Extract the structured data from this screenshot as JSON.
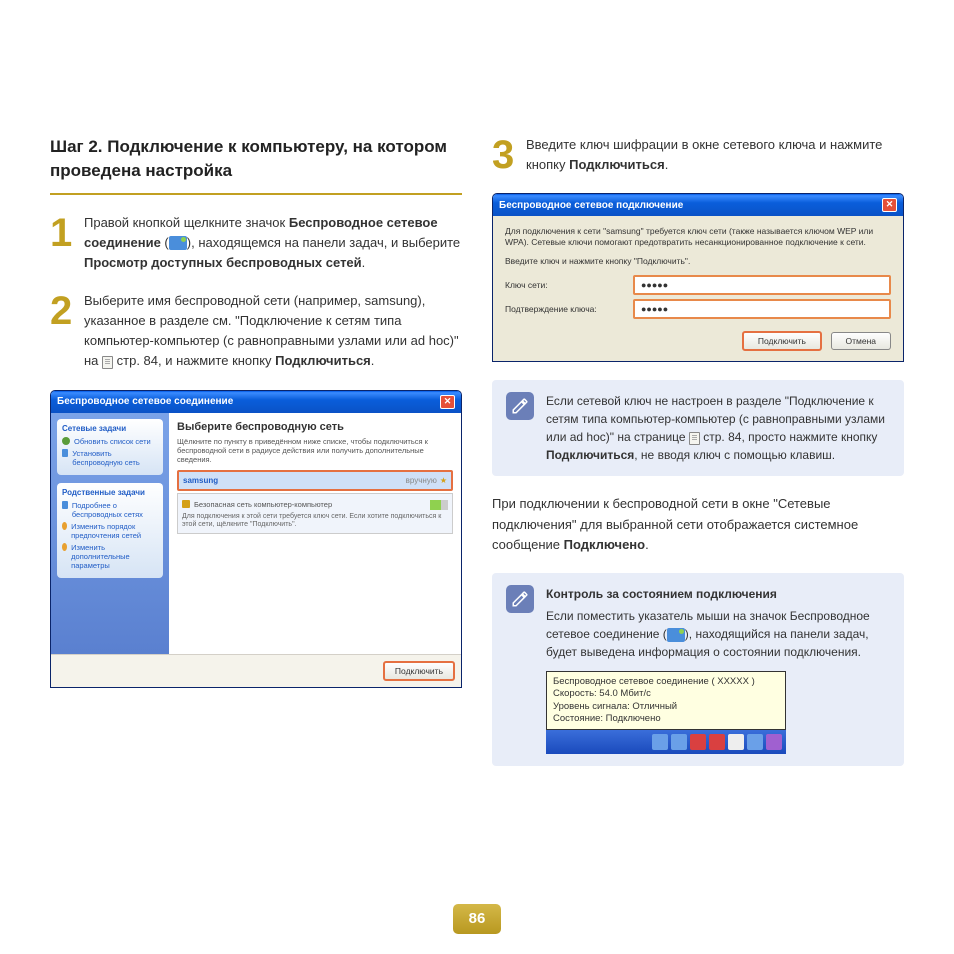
{
  "section_title": "Шаг 2. Подключение к компьютеру, на котором проведена настройка",
  "step1": {
    "p1a": "Правой кнопкой щелкните значок ",
    "p1b": "Беспроводное сетевое соединение",
    "p1c": " (",
    "p1d": "), находящемся на панели задач, и выберите ",
    "p1e": "Просмотр доступных беспроводных сетей",
    "p1f": "."
  },
  "step2": {
    "p1": "Выберите имя беспроводной сети (например, samsung), указанное в разделе см. \"Подключение к сетям типа компьютер-компьютер (с равноправными узлами или ad hoc)\" на ",
    "p2": " стр. 84, и нажмите кнопку ",
    "p2b": "Подключиться",
    "p2c": "."
  },
  "step3": {
    "p1": "Введите ключ шифрации в окне сетевого ключа и нажмите кнопку ",
    "p1b": "Подключиться",
    "p1c": "."
  },
  "win1": {
    "title": "Беспроводное сетевое соединение",
    "sidebar": {
      "panel1_title": "Сетевые задачи",
      "item1": "Обновить список сети",
      "item2": "Установить беспроводную сеть",
      "panel2_title": "Родственные задачи",
      "item3": "Подробнее о беспроводных сетях",
      "item4": "Изменить порядок предпочтения сетей",
      "item5": "Изменить дополнительные параметры"
    },
    "main_title": "Выберите беспроводную сеть",
    "main_sub": "Щёлкните по пункту в приведённом ниже списке, чтобы подключиться к беспроводной сети в радиусе действия или получить дополнительные сведения.",
    "net_name": "samsung",
    "net_status": "вручную",
    "net_type": "Безопасная сеть компьютер-компьютер",
    "net_desc": "Для подключения к этой сети требуется ключ сети. Если хотите подключиться к этой сети, щёлкните \"Подключить\".",
    "btn_connect": "Подключить"
  },
  "win2": {
    "title": "Беспроводное сетевое подключение",
    "txt1": "Для подключения к сети \"samsung\" требуется ключ сети (также называется ключом WEP или WPA). Сетевые ключи помогают предотвратить несанкционированное подключение к сети.",
    "txt2": "Введите ключ и нажмите кнопку \"Подключить\".",
    "label_key": "Ключ сети:",
    "label_confirm": "Подтверждение ключа:",
    "value_key": "●●●●●",
    "value_confirm": "●●●●●",
    "btn_connect": "Подключить",
    "btn_cancel": "Отмена"
  },
  "note1": {
    "p1": "Если сетевой ключ не настроен в разделе \"Подключение к сетям типа компьютер-компьютер (с равноправными узлами или ad hoc)\" на странице ",
    "p2": " стр. 84, просто нажмите кнопку ",
    "p2b": "Подключиться",
    "p2c": ", не вводя ключ с помощью клавиш."
  },
  "para1": {
    "p1": "При подключении к беспроводной сети в окне \"Сетевые подключения\" для выбранной сети отображается системное сообщение ",
    "p1b": "Подключено",
    "p1c": "."
  },
  "note2": {
    "title": "Контроль за состоянием подключения",
    "p1": "Если поместить указатель мыши на значок Беспроводное сетевое соединение (",
    "p2": "), находящийся на панели задач, будет выведена информация о состоянии подключения."
  },
  "tooltip": {
    "l1": "Беспроводное сетевое соединение ( XXXXX  )",
    "l2": "Скорость: 54.0 Мбит/с",
    "l3": "Уровень сигнала: Отличный",
    "l4": "Состояние: Подключено"
  },
  "page_num": "86"
}
